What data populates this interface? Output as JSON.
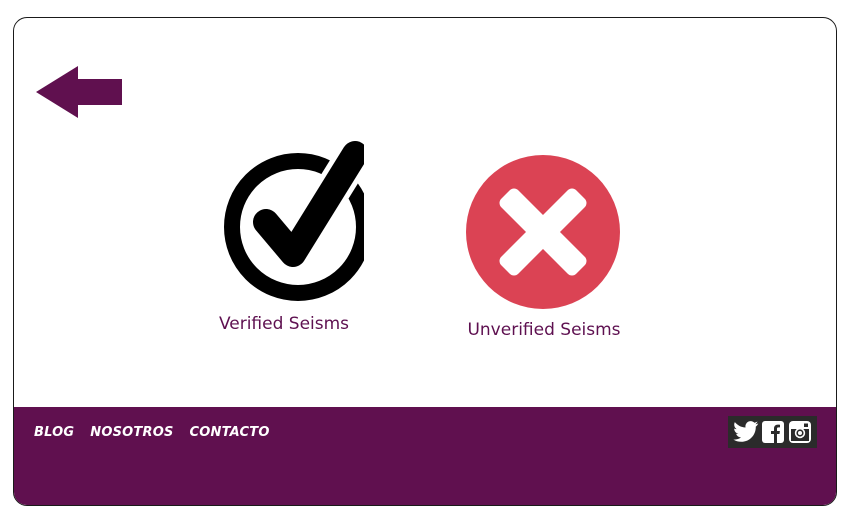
{
  "back": {
    "icon": "back-arrow-icon",
    "color": "#60104f"
  },
  "options": [
    {
      "label": "Verified Seisms",
      "icon": "check-circle-icon"
    },
    {
      "label": "Unverified Seisms",
      "icon": "x-circle-icon",
      "color": "#db4354"
    }
  ],
  "footer": {
    "color": "#60104f",
    "links": [
      "BLOG",
      "NOSOTROS",
      "CONTACTO"
    ],
    "social": [
      "twitter-icon",
      "facebook-icon",
      "instagram-icon"
    ]
  }
}
